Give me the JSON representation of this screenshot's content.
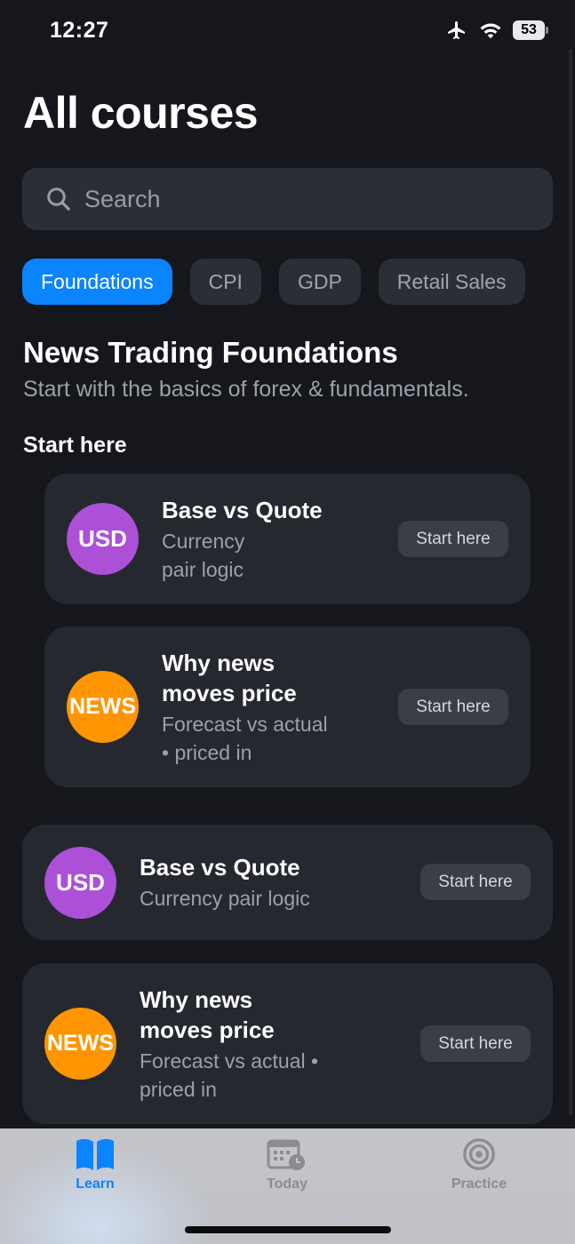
{
  "status_bar": {
    "time": "12:27",
    "battery": "53"
  },
  "page": {
    "title": "All courses"
  },
  "search": {
    "placeholder": "Search"
  },
  "chips": [
    {
      "label": "Foundations",
      "active": true
    },
    {
      "label": "CPI",
      "active": false
    },
    {
      "label": "GDP",
      "active": false
    },
    {
      "label": "Retail Sales",
      "active": false
    }
  ],
  "section": {
    "title": "News Trading Foundations",
    "subtitle": "Start with the basics of forex & fundamentals.",
    "start_header": "Start here"
  },
  "featured_cards": [
    {
      "badge": "USD",
      "title": "Base vs Quote",
      "subtitle_line1": "Currency",
      "subtitle_line2": "pair logic",
      "button": "Start here"
    },
    {
      "badge": "NEWS",
      "title_line1": "Why news",
      "title_line2": "moves price",
      "subtitle_line1": "Forecast vs actual",
      "subtitle_line2": "• priced in",
      "button": "Start here"
    }
  ],
  "course_cards": [
    {
      "badge": "USD",
      "title": "Base vs Quote",
      "subtitle": "Currency pair logic",
      "button": "Start here"
    },
    {
      "badge": "NEWS",
      "title_line1": "Why news",
      "title_line2": "moves price",
      "subtitle_line1": "Forecast vs actual •",
      "subtitle_line2": "priced in",
      "button": "Start here"
    }
  ],
  "tabs": [
    {
      "label": "Learn",
      "icon": "book-icon",
      "active": true
    },
    {
      "label": "Today",
      "icon": "calendar-clock-icon",
      "active": false
    },
    {
      "label": "Practice",
      "icon": "target-icon",
      "active": false
    }
  ],
  "colors": {
    "accent": "#0a84ff",
    "usd_badge": "#ac50d8",
    "news_badge": "#ff9500",
    "background": "#15171c",
    "card": "#262830"
  }
}
